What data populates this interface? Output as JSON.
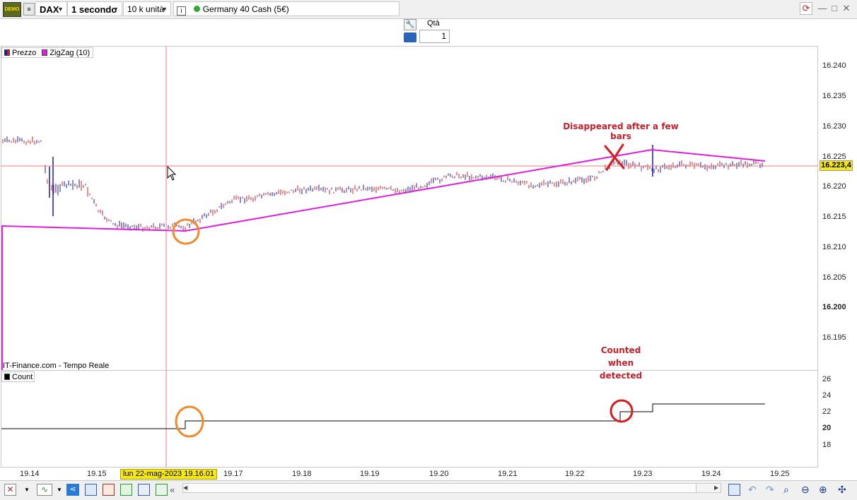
{
  "toolbar": {
    "demo_label": "DEMO",
    "instrument": "DAX",
    "timeframe": "1 secondo",
    "units": "10 k unità",
    "info_icon": "info-icon",
    "market_name": "Germany 40 Cash (5€)",
    "market_status_color": "#2eaa2e"
  },
  "order": {
    "qty_label": "Qtà",
    "qty_value": "1"
  },
  "price_pane": {
    "legend": [
      {
        "label": "Prezzo",
        "color": "#1a1a9a"
      },
      {
        "label": "ZigZag (10)",
        "color": "#e01ce0"
      }
    ],
    "source_label": "IT-Finance.com - Tempo Reale",
    "y_ticks": [
      "16.240",
      "16.235",
      "16.230",
      "16.225",
      "16.220",
      "16.215",
      "16.210",
      "16.205",
      "16.200",
      "16.195"
    ],
    "last_price": "16.223,4",
    "last_price_bg": "#f5e814"
  },
  "count_pane": {
    "legend": "Count",
    "y_ticks": [
      "26",
      "24",
      "22",
      "20",
      "18"
    ]
  },
  "time_axis": {
    "ticks": [
      "19.14",
      "19.15",
      "19.17",
      "19.18",
      "19.19",
      "19.20",
      "19.21",
      "19.22",
      "19.23",
      "19.24",
      "19.25"
    ],
    "cursor_label": "lun 22-mag-2023 19.16.01",
    "cursor_label_bg": "#f5e814"
  },
  "annotations": {
    "disappeared": "Disappeared after a few bars",
    "counted_1": "Counted",
    "counted_2": "when",
    "counted_3": "detected",
    "color": "#c8202a",
    "circle_orange": "#f08a2a",
    "circle_red": "#d81c1c"
  },
  "chart_data": {
    "type": "line",
    "series": [
      {
        "name": "ZigZag (10)",
        "x": [
          "19.14",
          "19.16.01",
          "19.22.40",
          "19.24.50"
        ],
        "y": [
          16213.5,
          16212.7,
          16226.0,
          16223.4
        ]
      },
      {
        "name": "Count",
        "x": [
          "19.14",
          "19.16.20",
          "19.22.60",
          "19.23.20",
          "19.24.50"
        ],
        "y": [
          20,
          21,
          22,
          23,
          23
        ]
      }
    ],
    "ylim_price": [
      16191,
      16243
    ],
    "ylim_count": [
      16,
      27
    ]
  }
}
